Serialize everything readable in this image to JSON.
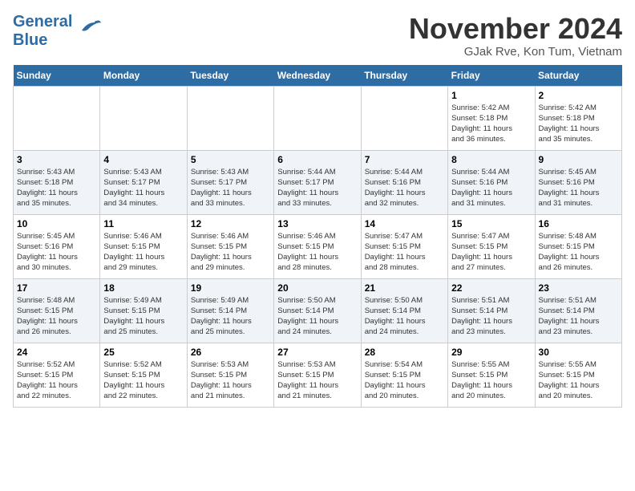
{
  "header": {
    "logo_general": "General",
    "logo_blue": "Blue",
    "month_title": "November 2024",
    "location": "GJak Rve, Kon Tum, Vietnam"
  },
  "days_of_week": [
    "Sunday",
    "Monday",
    "Tuesday",
    "Wednesday",
    "Thursday",
    "Friday",
    "Saturday"
  ],
  "weeks": [
    [
      {
        "day": "",
        "info": ""
      },
      {
        "day": "",
        "info": ""
      },
      {
        "day": "",
        "info": ""
      },
      {
        "day": "",
        "info": ""
      },
      {
        "day": "",
        "info": ""
      },
      {
        "day": "1",
        "info": "Sunrise: 5:42 AM\nSunset: 5:18 PM\nDaylight: 11 hours\nand 36 minutes."
      },
      {
        "day": "2",
        "info": "Sunrise: 5:42 AM\nSunset: 5:18 PM\nDaylight: 11 hours\nand 35 minutes."
      }
    ],
    [
      {
        "day": "3",
        "info": "Sunrise: 5:43 AM\nSunset: 5:18 PM\nDaylight: 11 hours\nand 35 minutes."
      },
      {
        "day": "4",
        "info": "Sunrise: 5:43 AM\nSunset: 5:17 PM\nDaylight: 11 hours\nand 34 minutes."
      },
      {
        "day": "5",
        "info": "Sunrise: 5:43 AM\nSunset: 5:17 PM\nDaylight: 11 hours\nand 33 minutes."
      },
      {
        "day": "6",
        "info": "Sunrise: 5:44 AM\nSunset: 5:17 PM\nDaylight: 11 hours\nand 33 minutes."
      },
      {
        "day": "7",
        "info": "Sunrise: 5:44 AM\nSunset: 5:16 PM\nDaylight: 11 hours\nand 32 minutes."
      },
      {
        "day": "8",
        "info": "Sunrise: 5:44 AM\nSunset: 5:16 PM\nDaylight: 11 hours\nand 31 minutes."
      },
      {
        "day": "9",
        "info": "Sunrise: 5:45 AM\nSunset: 5:16 PM\nDaylight: 11 hours\nand 31 minutes."
      }
    ],
    [
      {
        "day": "10",
        "info": "Sunrise: 5:45 AM\nSunset: 5:16 PM\nDaylight: 11 hours\nand 30 minutes."
      },
      {
        "day": "11",
        "info": "Sunrise: 5:46 AM\nSunset: 5:15 PM\nDaylight: 11 hours\nand 29 minutes."
      },
      {
        "day": "12",
        "info": "Sunrise: 5:46 AM\nSunset: 5:15 PM\nDaylight: 11 hours\nand 29 minutes."
      },
      {
        "day": "13",
        "info": "Sunrise: 5:46 AM\nSunset: 5:15 PM\nDaylight: 11 hours\nand 28 minutes."
      },
      {
        "day": "14",
        "info": "Sunrise: 5:47 AM\nSunset: 5:15 PM\nDaylight: 11 hours\nand 28 minutes."
      },
      {
        "day": "15",
        "info": "Sunrise: 5:47 AM\nSunset: 5:15 PM\nDaylight: 11 hours\nand 27 minutes."
      },
      {
        "day": "16",
        "info": "Sunrise: 5:48 AM\nSunset: 5:15 PM\nDaylight: 11 hours\nand 26 minutes."
      }
    ],
    [
      {
        "day": "17",
        "info": "Sunrise: 5:48 AM\nSunset: 5:15 PM\nDaylight: 11 hours\nand 26 minutes."
      },
      {
        "day": "18",
        "info": "Sunrise: 5:49 AM\nSunset: 5:15 PM\nDaylight: 11 hours\nand 25 minutes."
      },
      {
        "day": "19",
        "info": "Sunrise: 5:49 AM\nSunset: 5:14 PM\nDaylight: 11 hours\nand 25 minutes."
      },
      {
        "day": "20",
        "info": "Sunrise: 5:50 AM\nSunset: 5:14 PM\nDaylight: 11 hours\nand 24 minutes."
      },
      {
        "day": "21",
        "info": "Sunrise: 5:50 AM\nSunset: 5:14 PM\nDaylight: 11 hours\nand 24 minutes."
      },
      {
        "day": "22",
        "info": "Sunrise: 5:51 AM\nSunset: 5:14 PM\nDaylight: 11 hours\nand 23 minutes."
      },
      {
        "day": "23",
        "info": "Sunrise: 5:51 AM\nSunset: 5:14 PM\nDaylight: 11 hours\nand 23 minutes."
      }
    ],
    [
      {
        "day": "24",
        "info": "Sunrise: 5:52 AM\nSunset: 5:15 PM\nDaylight: 11 hours\nand 22 minutes."
      },
      {
        "day": "25",
        "info": "Sunrise: 5:52 AM\nSunset: 5:15 PM\nDaylight: 11 hours\nand 22 minutes."
      },
      {
        "day": "26",
        "info": "Sunrise: 5:53 AM\nSunset: 5:15 PM\nDaylight: 11 hours\nand 21 minutes."
      },
      {
        "day": "27",
        "info": "Sunrise: 5:53 AM\nSunset: 5:15 PM\nDaylight: 11 hours\nand 21 minutes."
      },
      {
        "day": "28",
        "info": "Sunrise: 5:54 AM\nSunset: 5:15 PM\nDaylight: 11 hours\nand 20 minutes."
      },
      {
        "day": "29",
        "info": "Sunrise: 5:55 AM\nSunset: 5:15 PM\nDaylight: 11 hours\nand 20 minutes."
      },
      {
        "day": "30",
        "info": "Sunrise: 5:55 AM\nSunset: 5:15 PM\nDaylight: 11 hours\nand 20 minutes."
      }
    ]
  ]
}
